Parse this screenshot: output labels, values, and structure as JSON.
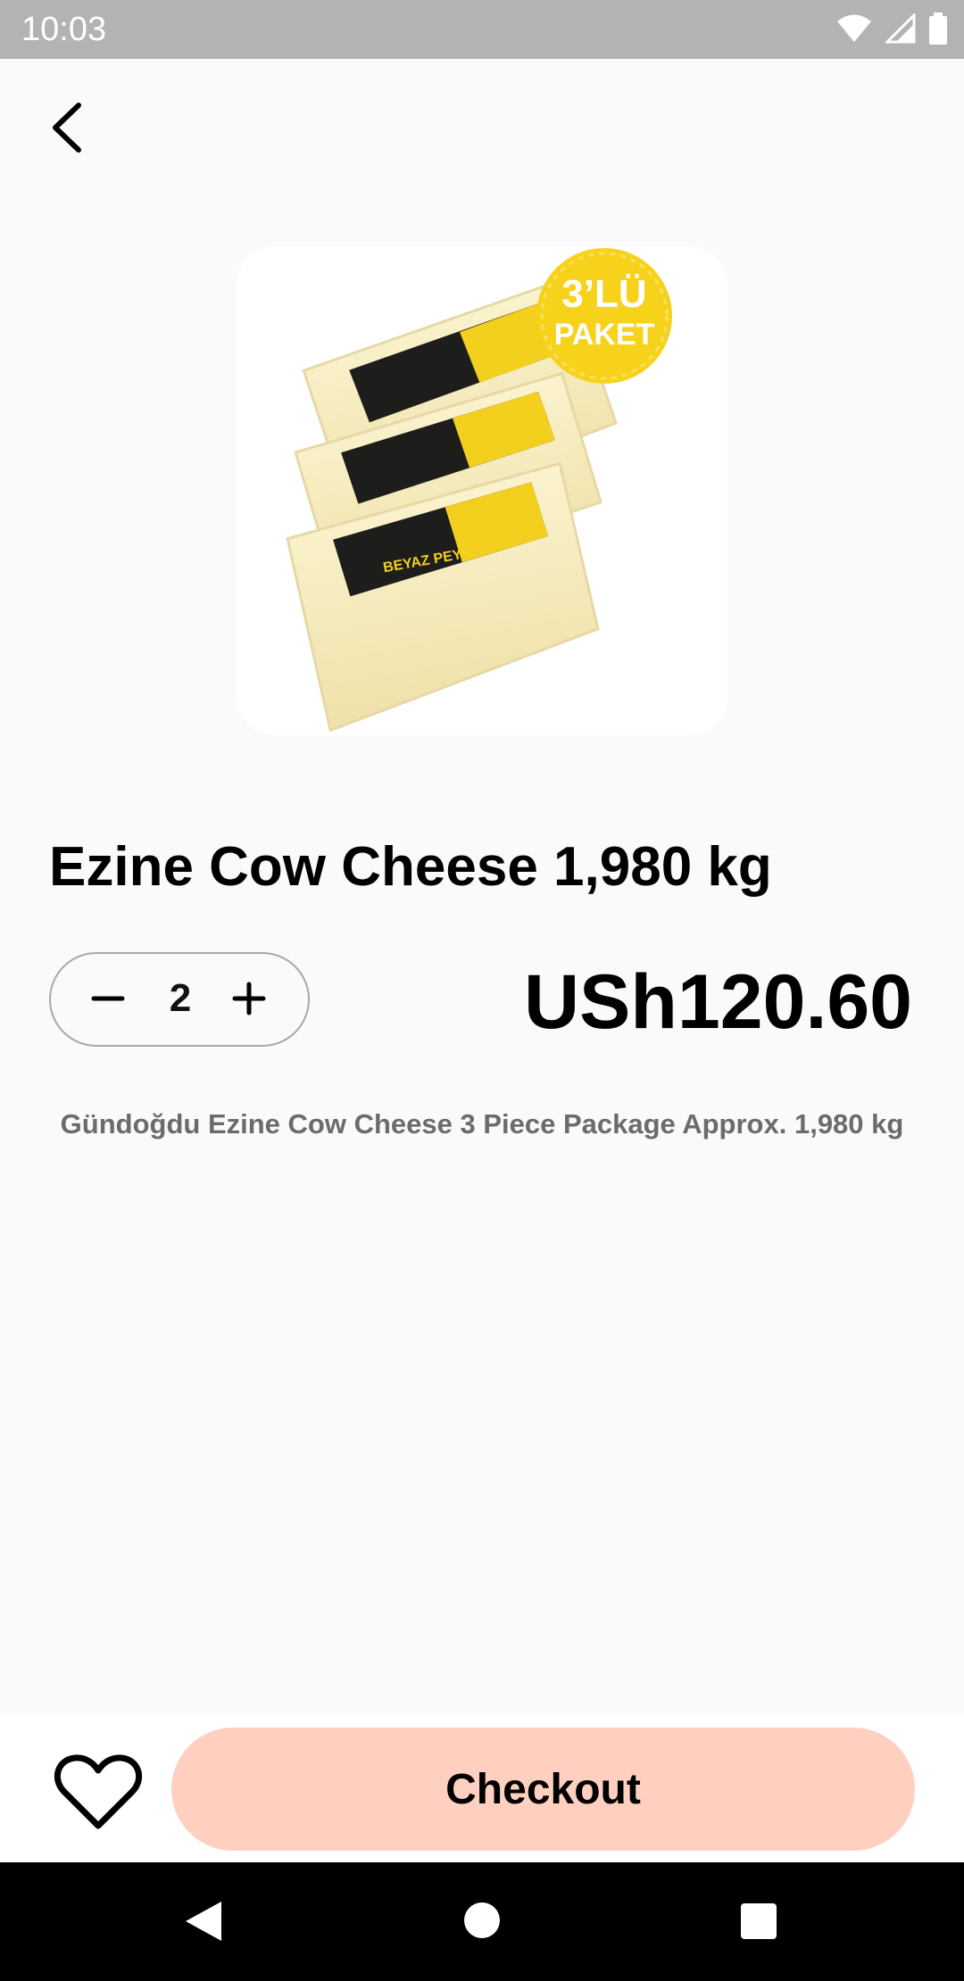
{
  "status_bar": {
    "time": "10:03"
  },
  "product": {
    "title": "Ezine Cow Cheese 1,980 kg",
    "price": "USh120.60",
    "description": "Gündoğdu Ezine Cow Cheese 3 Piece Package Approx. 1,980 kg",
    "image_badge_line1": "3’LÜ",
    "image_badge_line2": "PAKET",
    "label_text": "BEYAZ PEYNİR"
  },
  "quantity": {
    "value": "2"
  },
  "actions": {
    "checkout_label": "Checkout"
  },
  "colors": {
    "checkout_bg": "#ffcfc0",
    "status_bar_bg": "#b3b3b3",
    "background": "#fafafa",
    "badge_yellow": "#f7d21b"
  },
  "icons": {
    "back": "chevron-left-icon",
    "minus": "minus-icon",
    "plus": "plus-icon",
    "favorite": "heart-outline-icon",
    "nav_back": "triangle-back-icon",
    "nav_home": "circle-home-icon",
    "nav_recents": "square-recents-icon"
  }
}
